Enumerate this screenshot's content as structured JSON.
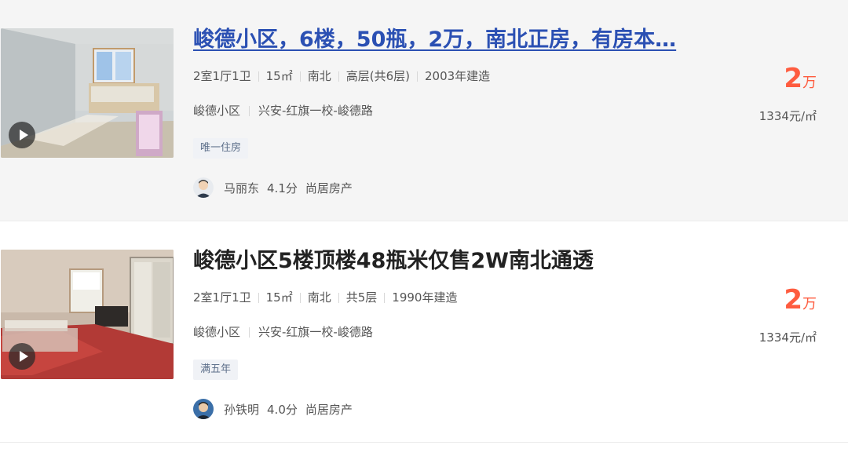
{
  "listings": [
    {
      "title": "峻德小区，6楼，50瓶，2万，南北正房，有房本…",
      "layout": "2室1厅1卫",
      "area": "15㎡",
      "orientation": "南北",
      "floor": "高层(共6层)",
      "built": "2003年建造",
      "community": "峻德小区",
      "district": "兴安-红旗一校-峻德路",
      "tag": "唯一住房",
      "agent_name": "马丽东",
      "agent_score": "4.1分",
      "agent_company": "尚居房产",
      "price": "2",
      "price_unit": "万",
      "unit_price": "1334元/㎡"
    },
    {
      "title": "峻德小区5楼顶楼48瓶米仅售2W南北通透",
      "layout": "2室1厅1卫",
      "area": "15㎡",
      "orientation": "南北",
      "floor": "共5层",
      "built": "1990年建造",
      "community": "峻德小区",
      "district": "兴安-红旗一校-峻德路",
      "tag": "满五年",
      "agent_name": "孙铁明",
      "agent_score": "4.0分",
      "agent_company": "尚居房产",
      "price": "2",
      "price_unit": "万",
      "unit_price": "1334元/㎡"
    }
  ],
  "icons": {
    "play": "play-icon",
    "avatar": "agent-avatar"
  },
  "colors": {
    "price": "#fe5c3f",
    "title_hover": "#2b50b3",
    "tag_bg": "#f0f2f6",
    "hover_bg": "#f5f5f5"
  }
}
